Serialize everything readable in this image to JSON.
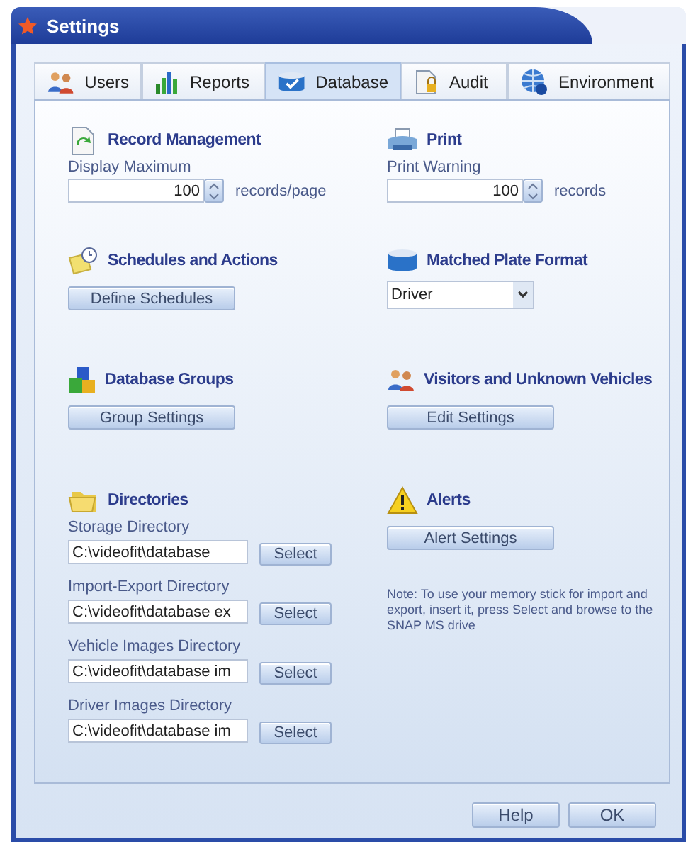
{
  "window": {
    "title": "Settings"
  },
  "tabs": [
    {
      "label": "Users",
      "selected": false
    },
    {
      "label": "Reports",
      "selected": false
    },
    {
      "label": "Database",
      "selected": true
    },
    {
      "label": "Audit",
      "selected": false
    },
    {
      "label": "Environment",
      "selected": false
    }
  ],
  "sections": [
    {
      "kind": "spinner",
      "heading": "Record Management",
      "label": "Display Maximum",
      "value": "100",
      "unit": "records/page"
    },
    {
      "kind": "spinner",
      "heading": "Print",
      "label": "Print Warning",
      "value": "100",
      "unit": "records"
    },
    {
      "kind": "button",
      "heading": "Schedules and Actions",
      "button": "Define Schedules"
    },
    {
      "kind": "dropdown",
      "heading": "Matched Plate Format",
      "value": "Driver"
    },
    {
      "kind": "button",
      "heading": "Database Groups",
      "button": "Group Settings"
    },
    {
      "kind": "button",
      "heading": "Visitors and Unknown Vehicles",
      "button": "Edit Settings"
    },
    {
      "kind": "directories",
      "heading": "Directories",
      "directories": [
        {
          "label": "Storage Directory",
          "value": "C:\\videofit\\database",
          "button": "Select"
        },
        {
          "label": "Import-Export Directory",
          "value": "C:\\videofit\\database ex",
          "button": "Select"
        },
        {
          "label": "Vehicle Images Directory",
          "value": "C:\\videofit\\database im",
          "button": "Select"
        },
        {
          "label": "Driver Images Directory",
          "value": "C:\\videofit\\database im",
          "button": "Select"
        }
      ]
    },
    {
      "kind": "button",
      "heading": "Alerts",
      "button": "Alert Settings",
      "note": "Note: To use your memory stick for import and export, insert it, press Select and browse to the SNAP MS drive"
    }
  ],
  "buttons": [
    "Help",
    "OK"
  ]
}
